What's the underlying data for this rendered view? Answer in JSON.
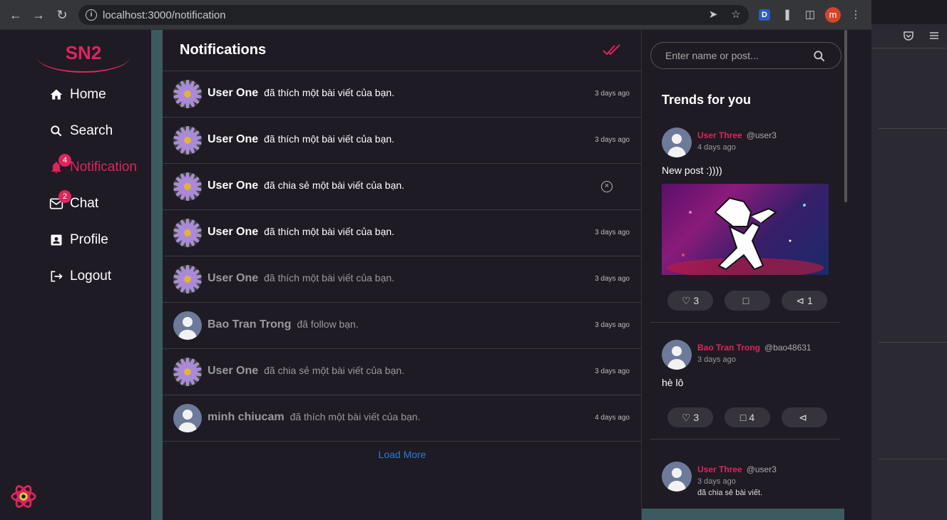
{
  "browser": {
    "url": "localhost:3000/notification",
    "ext_label": "D",
    "profile_initial": "m"
  },
  "app": {
    "logo": "SN2",
    "nav": [
      {
        "label": "Home"
      },
      {
        "label": "Search"
      },
      {
        "label": "Notification",
        "badge": "4"
      },
      {
        "label": "Chat",
        "badge": "2"
      },
      {
        "label": "Profile"
      },
      {
        "label": "Logout"
      }
    ]
  },
  "main": {
    "title": "Notifications",
    "notifications": [
      {
        "name": "User One",
        "action": "đã thích một bài viết của bạn.",
        "time": "3 days ago"
      },
      {
        "name": "User One",
        "action": "đã thích một bài viết của bạn.",
        "time": "3 days ago"
      },
      {
        "name": "User One",
        "action": "đã chia sẻ một bài viết của bạn.",
        "time": ""
      },
      {
        "name": "User One",
        "action": "đã thích một bài viết của bạn.",
        "time": "3 days ago"
      },
      {
        "name": "User One",
        "action": "đã thích một bài viết của bạn.",
        "time": "3 days ago"
      },
      {
        "name": "Bao Tran Trong",
        "action": "đã follow bạn.",
        "time": "3 days ago"
      },
      {
        "name": "User One",
        "action": "đã chia sẻ một bài viết của bạn.",
        "time": "3 days ago"
      },
      {
        "name": "minh chiucam",
        "action": "đã thích một bài viết của bạn.",
        "time": "4 days ago"
      }
    ],
    "load_more": "Load More"
  },
  "right": {
    "search_placeholder": "Enter name or post...",
    "trends_title": "Trends for you",
    "posts": [
      {
        "name": "User Three",
        "handle": "@user3",
        "time": "4 days ago",
        "text": "New post :))))",
        "likes": "3",
        "comments": "",
        "shares": "1"
      },
      {
        "name": "Bao Tran Trong",
        "handle": "@bao48631",
        "time": "3 days ago",
        "text": "hè lô",
        "likes": "3",
        "comments": "4",
        "shares": ""
      },
      {
        "name": "User Three",
        "handle": "@user3",
        "time": "3 days ago",
        "text": "đã chia sẻ bài viết."
      }
    ]
  },
  "colors": {
    "accent": "#e0245e",
    "link": "#2f7bd6",
    "bg": "#1e1b24"
  }
}
